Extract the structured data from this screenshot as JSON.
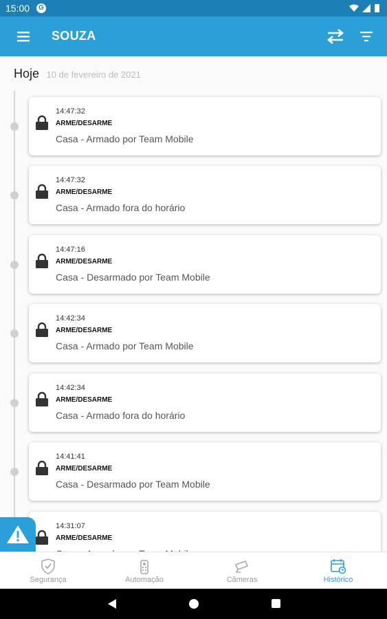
{
  "status_bar": {
    "time": "15:00",
    "app_badge": "G"
  },
  "app_bar": {
    "title": "SOUZA"
  },
  "timeline": {
    "day_label": "Hoje",
    "date_label": "10 de fevereiro de 2021",
    "events": [
      {
        "time": "14:47:32",
        "category": "ARME/DESARME",
        "description": "Casa - Armado por Team Mobile"
      },
      {
        "time": "14:47:32",
        "category": "ARME/DESARME",
        "description": "Casa - Armado fora do horário"
      },
      {
        "time": "14:47:16",
        "category": "ARME/DESARME",
        "description": "Casa - Desarmado por Team Mobile"
      },
      {
        "time": "14:42:34",
        "category": "ARME/DESARME",
        "description": "Casa - Armado por Team Mobile"
      },
      {
        "time": "14:42:34",
        "category": "ARME/DESARME",
        "description": "Casa - Armado fora do horário"
      },
      {
        "time": "14:41:41",
        "category": "ARME/DESARME",
        "description": "Casa - Desarmado por Team Mobile"
      },
      {
        "time": "14:31:07",
        "category": "ARME/DESARME",
        "description": "Casa - Armado por Team Mobile"
      }
    ]
  },
  "bottom_nav": {
    "items": [
      {
        "label": "Segurança",
        "icon": "shield-check-icon"
      },
      {
        "label": "Automação",
        "icon": "remote-control-icon"
      },
      {
        "label": "Câmeras",
        "icon": "security-camera-icon"
      },
      {
        "label": "Histórico",
        "icon": "calendar-history-icon"
      }
    ],
    "active_index": 3
  },
  "colors": {
    "accent": "#2a9fd8",
    "status_bar": "#1c7fb5",
    "timeline": "#d0d0d0"
  }
}
